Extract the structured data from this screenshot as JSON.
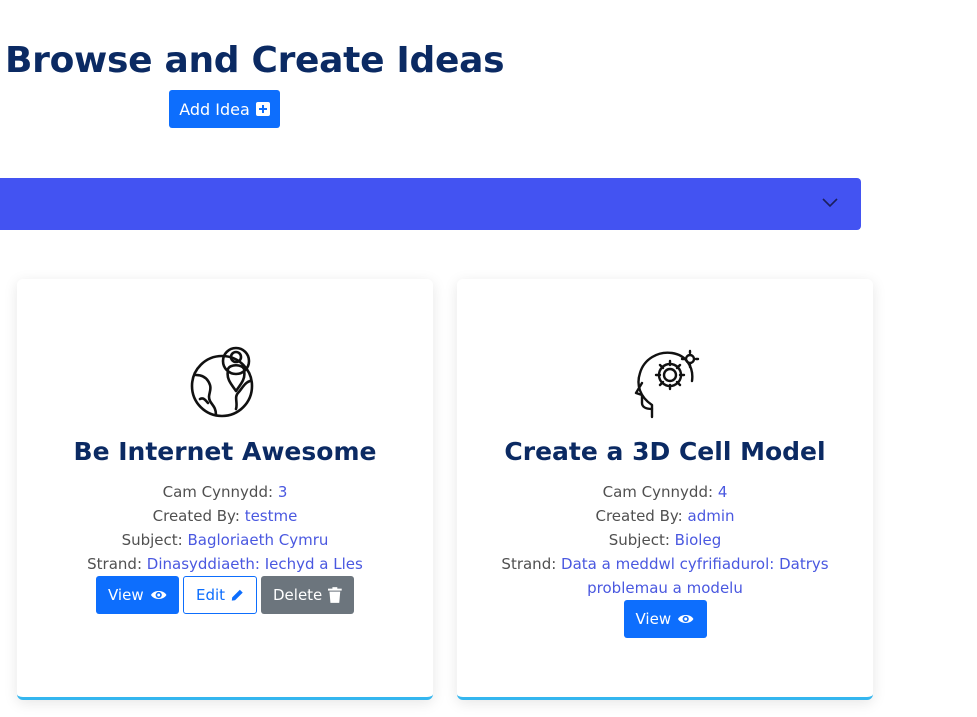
{
  "header": {
    "title": "Browse and Create Ideas",
    "add_button_label": "Add Idea"
  },
  "filter_bar": {
    "color": "#4353f2"
  },
  "labels": {
    "cam": "Cam Cynnydd:",
    "created_by": "Created By:",
    "subject": "Subject:",
    "strand": "Strand:"
  },
  "cards": [
    {
      "icon": "globe-person-icon",
      "title": "Be Internet Awesome",
      "cam": "3",
      "created_by": "testme",
      "subject": "Bagloriaeth Cymru",
      "strand": "Dinasyddiaeth: Iechyd a Lles",
      "buttons": {
        "view": "View",
        "edit": "Edit",
        "delete": "Delete"
      }
    },
    {
      "icon": "head-gear-icon",
      "title": "Create a 3D Cell Model",
      "cam": "4",
      "created_by": "admin",
      "subject": "Bioleg",
      "strand": "Data a meddwl cyfrifiadurol: Datrys problemau a modelu",
      "buttons": {
        "view": "View"
      }
    }
  ],
  "colors": {
    "title": "#0b2a63",
    "primary": "#0d6efd",
    "link": "#4a58e0",
    "secondary": "#6c757d",
    "card_accent": "#34b6ef"
  }
}
